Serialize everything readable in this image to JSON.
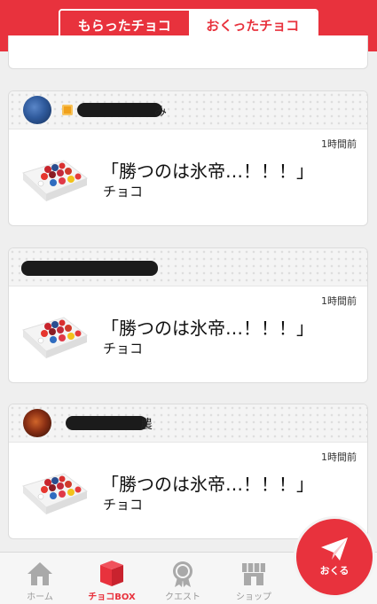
{
  "tabs": {
    "received": "もらったチョコ",
    "sent": "おくったチョコ"
  },
  "cards": [
    {
      "name_tail": "み",
      "time": "1時間前",
      "message": "「勝つのは氷帝…！！！」",
      "type": "チョコ"
    },
    {
      "name_tail": "",
      "time": "1時間前",
      "message": "「勝つのは氷帝…！！！」",
      "type": "チョコ"
    },
    {
      "name_tail": "農",
      "time": "1時間前",
      "message": "「勝つのは氷帝…！！！」",
      "type": "チョコ"
    }
  ],
  "nav": {
    "home": "ホーム",
    "chocobox": "チョコBOX",
    "quest": "クエスト",
    "shop": "ショップ"
  },
  "fab": {
    "label": "おくる"
  },
  "colors": {
    "accent": "#e8323d"
  },
  "icons": [
    "home-icon",
    "gift-box-icon",
    "medal-icon",
    "shop-icon",
    "paper-plane-icon"
  ]
}
